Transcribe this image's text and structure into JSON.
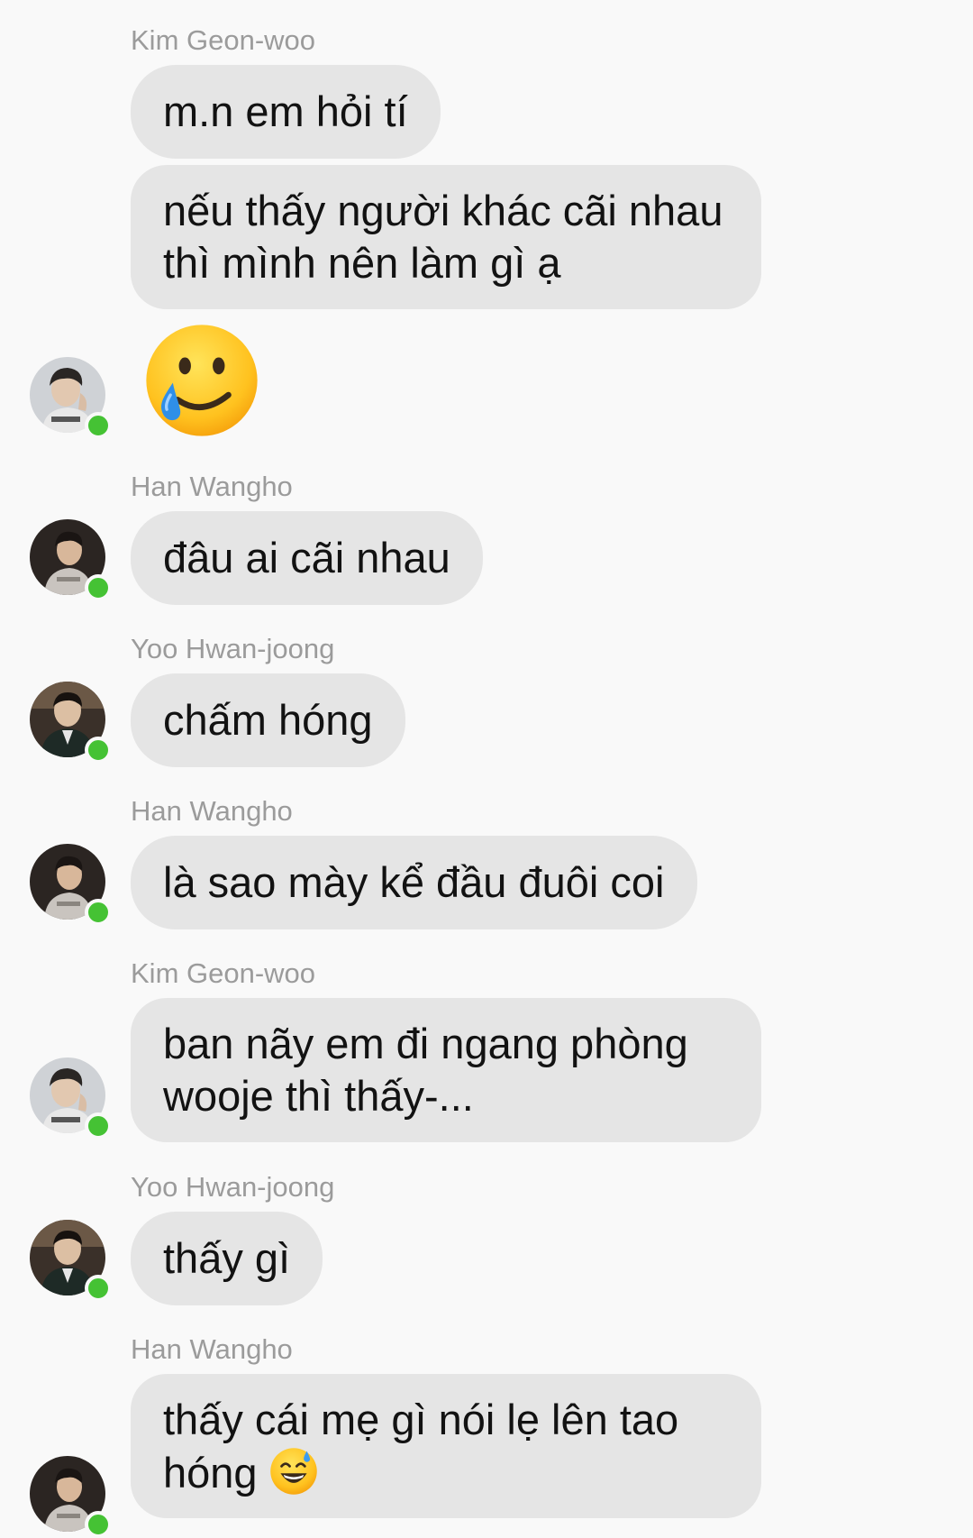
{
  "messages": [
    {
      "sender": "Kim Geon-woo",
      "texts": [
        "m.n em hỏi tí",
        "nếu thấy người khác cãi nhau thì mình nên làm gì ạ"
      ],
      "sticker": "smiling-face-with-tear-emoji"
    },
    {
      "sender": "Han Wangho",
      "texts": [
        "đâu ai cãi nhau"
      ]
    },
    {
      "sender": "Yoo Hwan-joong",
      "texts": [
        "chấm hóng"
      ]
    },
    {
      "sender": "Han Wangho",
      "texts": [
        "là sao mày kể đầu đuôi coi"
      ]
    },
    {
      "sender": "Kim Geon-woo",
      "texts": [
        "ban nãy em đi ngang phòng wooje thì thấy-..."
      ]
    },
    {
      "sender": "Yoo Hwan-joong",
      "texts": [
        "thấy gì"
      ]
    },
    {
      "sender": "Han Wangho",
      "texts": [
        "thấy cái mẹ gì nói lẹ lên tao hóng"
      ],
      "inline_emoji": "grinning-face-with-sweat-emoji"
    }
  ],
  "colors": {
    "background": "#f9f9f9",
    "bubble": "#e5e5e5",
    "sender_name": "#9b9b9b",
    "message_text": "#121212",
    "online_dot": "#45c234"
  }
}
